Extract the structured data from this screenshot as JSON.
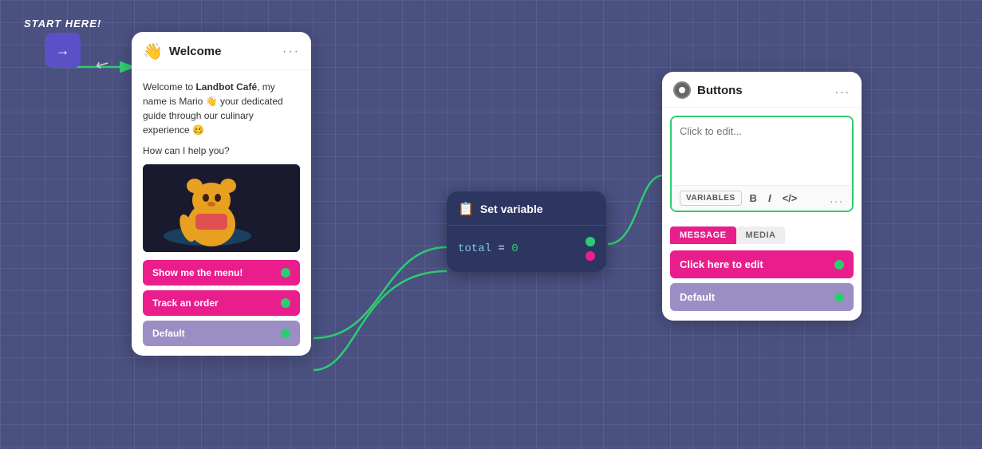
{
  "start_here": {
    "label": "START HERE!",
    "button_icon": "→"
  },
  "welcome_card": {
    "title": "Welcome",
    "emoji": "👋",
    "message_part1": "Welcome to ",
    "message_bold": "Landbot Café",
    "message_part2": ", my name is Mario 👋 your dedicated guide through our culinary experience 🥴",
    "question": "How can I help you?",
    "buttons": [
      {
        "label": "Show me the menu!",
        "type": "pink"
      },
      {
        "label": "Track an order",
        "type": "pink"
      },
      {
        "label": "Default",
        "type": "purple"
      }
    ]
  },
  "variable_card": {
    "title": "Set variable",
    "icon": "📋",
    "code": "total = 0",
    "var_name": "total",
    "var_op": " = ",
    "var_val": "0"
  },
  "buttons_card": {
    "title": "Buttons",
    "edit_placeholder": "Click to edit...",
    "toolbar": {
      "variables_label": "VARIABLES",
      "bold_label": "B",
      "italic_label": "I",
      "code_label": "</>",
      "more_label": "..."
    },
    "tabs": [
      {
        "label": "MESSAGE",
        "active": true
      },
      {
        "label": "MEDIA",
        "active": false
      }
    ],
    "buttons": [
      {
        "label": "Click here to edit",
        "type": "pink"
      },
      {
        "label": "Default",
        "type": "purple"
      }
    ],
    "menu_dots": "..."
  },
  "colors": {
    "pink": "#e91e8c",
    "purple_light": "#9b8ec4",
    "dark_bg": "#2d3561",
    "green": "#2ecc71",
    "canvas_bg": "#4a5080"
  }
}
